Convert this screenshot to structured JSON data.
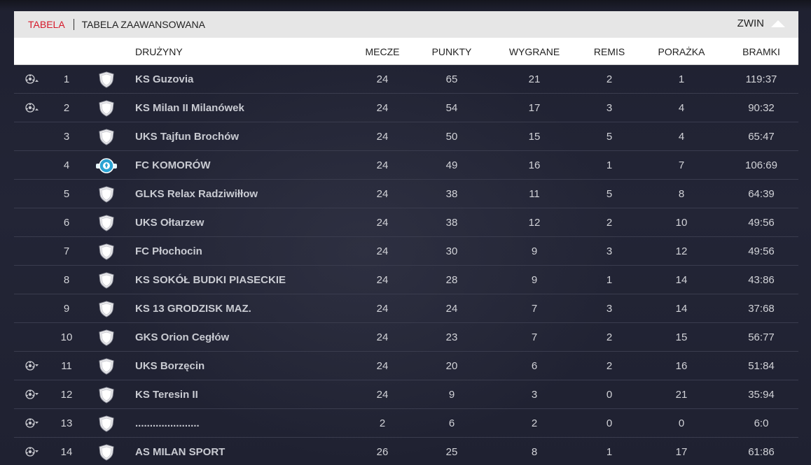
{
  "tabs": {
    "active": "TABELA",
    "advanced": "TABELA ZAAWANSOWANA",
    "collapse": "ZWIN"
  },
  "columns": {
    "team": "DRUŻYNY",
    "matches": "MECZE",
    "points": "PUNKTY",
    "wins": "WYGRANE",
    "draws": "REMIS",
    "losses": "PORAŻKA",
    "goals": "BRAMKI"
  },
  "colors": {
    "accent": "#d6192a",
    "header_bar": "#e6e6e6",
    "background": "#1e2030"
  },
  "rows": [
    {
      "pos": "1",
      "team": "KS Guzovia",
      "matches": "24",
      "points": "65",
      "wins": "21",
      "draws": "2",
      "losses": "1",
      "goals": "119:37",
      "indicator": "ball-up",
      "badge": "shield"
    },
    {
      "pos": "2",
      "team": "KS Milan II Milanówek",
      "matches": "24",
      "points": "54",
      "wins": "17",
      "draws": "3",
      "losses": "4",
      "goals": "90:32",
      "indicator": "ball-up",
      "badge": "shield"
    },
    {
      "pos": "3",
      "team": "UKS Tajfun Brochów",
      "matches": "24",
      "points": "50",
      "wins": "15",
      "draws": "5",
      "losses": "4",
      "goals": "65:47",
      "indicator": "none",
      "badge": "shield"
    },
    {
      "pos": "4",
      "team": "FC KOMORÓW",
      "matches": "24",
      "points": "49",
      "wins": "16",
      "draws": "1",
      "losses": "7",
      "goals": "106:69",
      "indicator": "none",
      "badge": "crest"
    },
    {
      "pos": "5",
      "team": "GLKS Relax Radziwiłłow",
      "matches": "24",
      "points": "38",
      "wins": "11",
      "draws": "5",
      "losses": "8",
      "goals": "64:39",
      "indicator": "none",
      "badge": "shield"
    },
    {
      "pos": "6",
      "team": "UKS Ołtarzew",
      "matches": "24",
      "points": "38",
      "wins": "12",
      "draws": "2",
      "losses": "10",
      "goals": "49:56",
      "indicator": "none",
      "badge": "shield"
    },
    {
      "pos": "7",
      "team": "FC Płochocin",
      "matches": "24",
      "points": "30",
      "wins": "9",
      "draws": "3",
      "losses": "12",
      "goals": "49:56",
      "indicator": "none",
      "badge": "shield"
    },
    {
      "pos": "8",
      "team": "KS SOKÓŁ BUDKI PIASECKIE",
      "matches": "24",
      "points": "28",
      "wins": "9",
      "draws": "1",
      "losses": "14",
      "goals": "43:86",
      "indicator": "none",
      "badge": "shield"
    },
    {
      "pos": "9",
      "team": "KS 13 GRODZISK MAZ.",
      "matches": "24",
      "points": "24",
      "wins": "7",
      "draws": "3",
      "losses": "14",
      "goals": "37:68",
      "indicator": "none",
      "badge": "shield"
    },
    {
      "pos": "10",
      "team": "GKS Orion Cegłów",
      "matches": "24",
      "points": "23",
      "wins": "7",
      "draws": "2",
      "losses": "15",
      "goals": "56:77",
      "indicator": "none",
      "badge": "shield"
    },
    {
      "pos": "11",
      "team": "UKS Borzęcin",
      "matches": "24",
      "points": "20",
      "wins": "6",
      "draws": "2",
      "losses": "16",
      "goals": "51:84",
      "indicator": "ball-down",
      "badge": "shield"
    },
    {
      "pos": "12",
      "team": "KS Teresin II",
      "matches": "24",
      "points": "9",
      "wins": "3",
      "draws": "0",
      "losses": "21",
      "goals": "35:94",
      "indicator": "ball-down",
      "badge": "shield"
    },
    {
      "pos": "13",
      "team": "......................",
      "matches": "2",
      "points": "6",
      "wins": "2",
      "draws": "0",
      "losses": "0",
      "goals": "6:0",
      "indicator": "ball-down",
      "badge": "shield"
    },
    {
      "pos": "14",
      "team": "AS MILAN SPORT",
      "matches": "26",
      "points": "25",
      "wins": "8",
      "draws": "1",
      "losses": "17",
      "goals": "61:86",
      "indicator": "ball-down",
      "badge": "shield"
    }
  ]
}
